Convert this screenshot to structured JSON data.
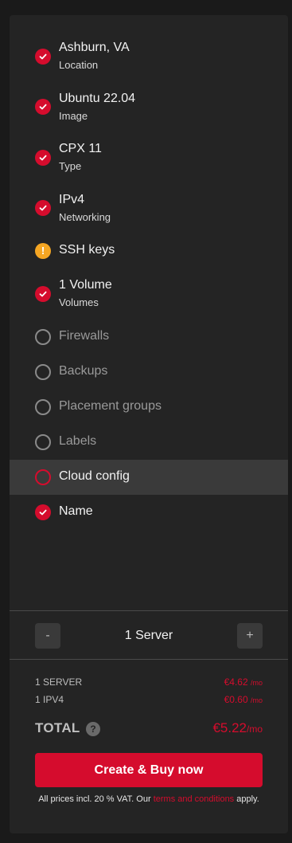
{
  "steps": [
    {
      "title": "Ashburn, VA",
      "subtitle": "Location",
      "status": "done"
    },
    {
      "title": "Ubuntu 22.04",
      "subtitle": "Image",
      "status": "done"
    },
    {
      "title": "CPX 11",
      "subtitle": "Type",
      "status": "done"
    },
    {
      "title": "IPv4",
      "subtitle": "Networking",
      "status": "done"
    },
    {
      "title": "SSH keys",
      "subtitle": "",
      "status": "warning"
    },
    {
      "title": "1 Volume",
      "subtitle": "Volumes",
      "status": "done"
    },
    {
      "title": "Firewalls",
      "subtitle": "",
      "status": "empty"
    },
    {
      "title": "Backups",
      "subtitle": "",
      "status": "empty"
    },
    {
      "title": "Placement groups",
      "subtitle": "",
      "status": "empty"
    },
    {
      "title": "Labels",
      "subtitle": "",
      "status": "empty"
    },
    {
      "title": "Cloud config",
      "subtitle": "",
      "status": "active"
    },
    {
      "title": "Name",
      "subtitle": "",
      "status": "done"
    }
  ],
  "icons": {
    "done": "check-circle-icon",
    "warning": "exclamation-circle-icon",
    "empty": "empty-circle-icon",
    "active": "empty-red-circle-icon"
  },
  "server_count": {
    "decrement_label": "-",
    "label": "1 Server",
    "increment_label": "+"
  },
  "summary": {
    "items": [
      {
        "label": "1 SERVER",
        "price": "€4.62",
        "unit": "/mo"
      },
      {
        "label": "1 IPV4",
        "price": "€0.60",
        "unit": "/mo"
      }
    ],
    "total_label": "TOTAL",
    "help_label": "?",
    "total_price": "€5.22",
    "total_unit": "/mo"
  },
  "cta_label": "Create & Buy now",
  "vat_note": {
    "before": "All prices incl. 20 % VAT. Our ",
    "link": "terms and conditions",
    "after": " apply."
  },
  "colors": {
    "accent": "#d50c2d",
    "warning": "#f5a623",
    "background": "#242424"
  }
}
